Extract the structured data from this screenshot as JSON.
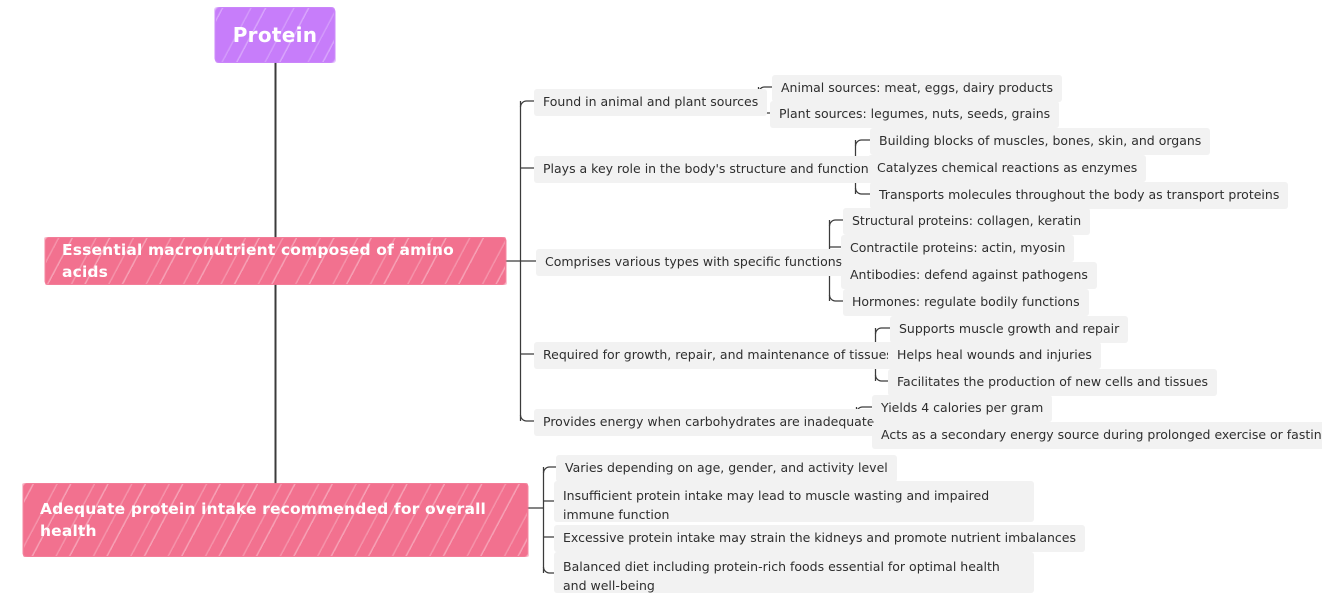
{
  "diagram": {
    "type": "mind-map",
    "title": "Protein",
    "colors": {
      "root": "#c77dfa",
      "branch": "#f2718f",
      "leaf_background": "#f2f2f2",
      "connector": "#3b3b3b",
      "canvas": "#ffffff"
    }
  },
  "root": {
    "label": "Protein"
  },
  "branches": [
    {
      "label": "Essential macronutrient composed of amino acids",
      "topics": [
        {
          "label": "Found in animal and plant sources",
          "subtopics": [
            {
              "label": "Animal sources: meat, eggs, dairy products"
            },
            {
              "label": "Plant sources: legumes, nuts, seeds, grains"
            }
          ]
        },
        {
          "label": "Plays a key role in the body's structure and function",
          "subtopics": [
            {
              "label": "Building blocks of muscles, bones, skin, and organs"
            },
            {
              "label": "Catalyzes chemical reactions as enzymes"
            },
            {
              "label": "Transports molecules throughout the body as transport proteins"
            }
          ]
        },
        {
          "label": "Comprises various types with specific functions",
          "subtopics": [
            {
              "label": "Structural proteins: collagen, keratin"
            },
            {
              "label": "Contractile proteins: actin, myosin"
            },
            {
              "label": "Antibodies: defend against pathogens"
            },
            {
              "label": "Hormones: regulate bodily functions"
            }
          ]
        },
        {
          "label": "Required for growth, repair, and maintenance of tissues",
          "subtopics": [
            {
              "label": "Supports muscle growth and repair"
            },
            {
              "label": "Helps heal wounds and injuries"
            },
            {
              "label": "Facilitates the production of new cells and tissues"
            }
          ]
        },
        {
          "label": "Provides energy when carbohydrates are inadequate",
          "subtopics": [
            {
              "label": "Yields 4 calories per gram"
            },
            {
              "label": "Acts as a secondary energy source during prolonged exercise or fasting"
            }
          ]
        }
      ]
    },
    {
      "label": "Adequate protein intake recommended for overall health",
      "topics": [
        {
          "label": "Varies depending on age, gender, and activity level"
        },
        {
          "label": "Insufficient protein intake may lead to muscle wasting and impaired immune function"
        },
        {
          "label": "Excessive protein intake may strain the kidneys and promote nutrient imbalances"
        },
        {
          "label": "Balanced diet including protein-rich foods essential for optimal health and well-being"
        }
      ]
    }
  ]
}
